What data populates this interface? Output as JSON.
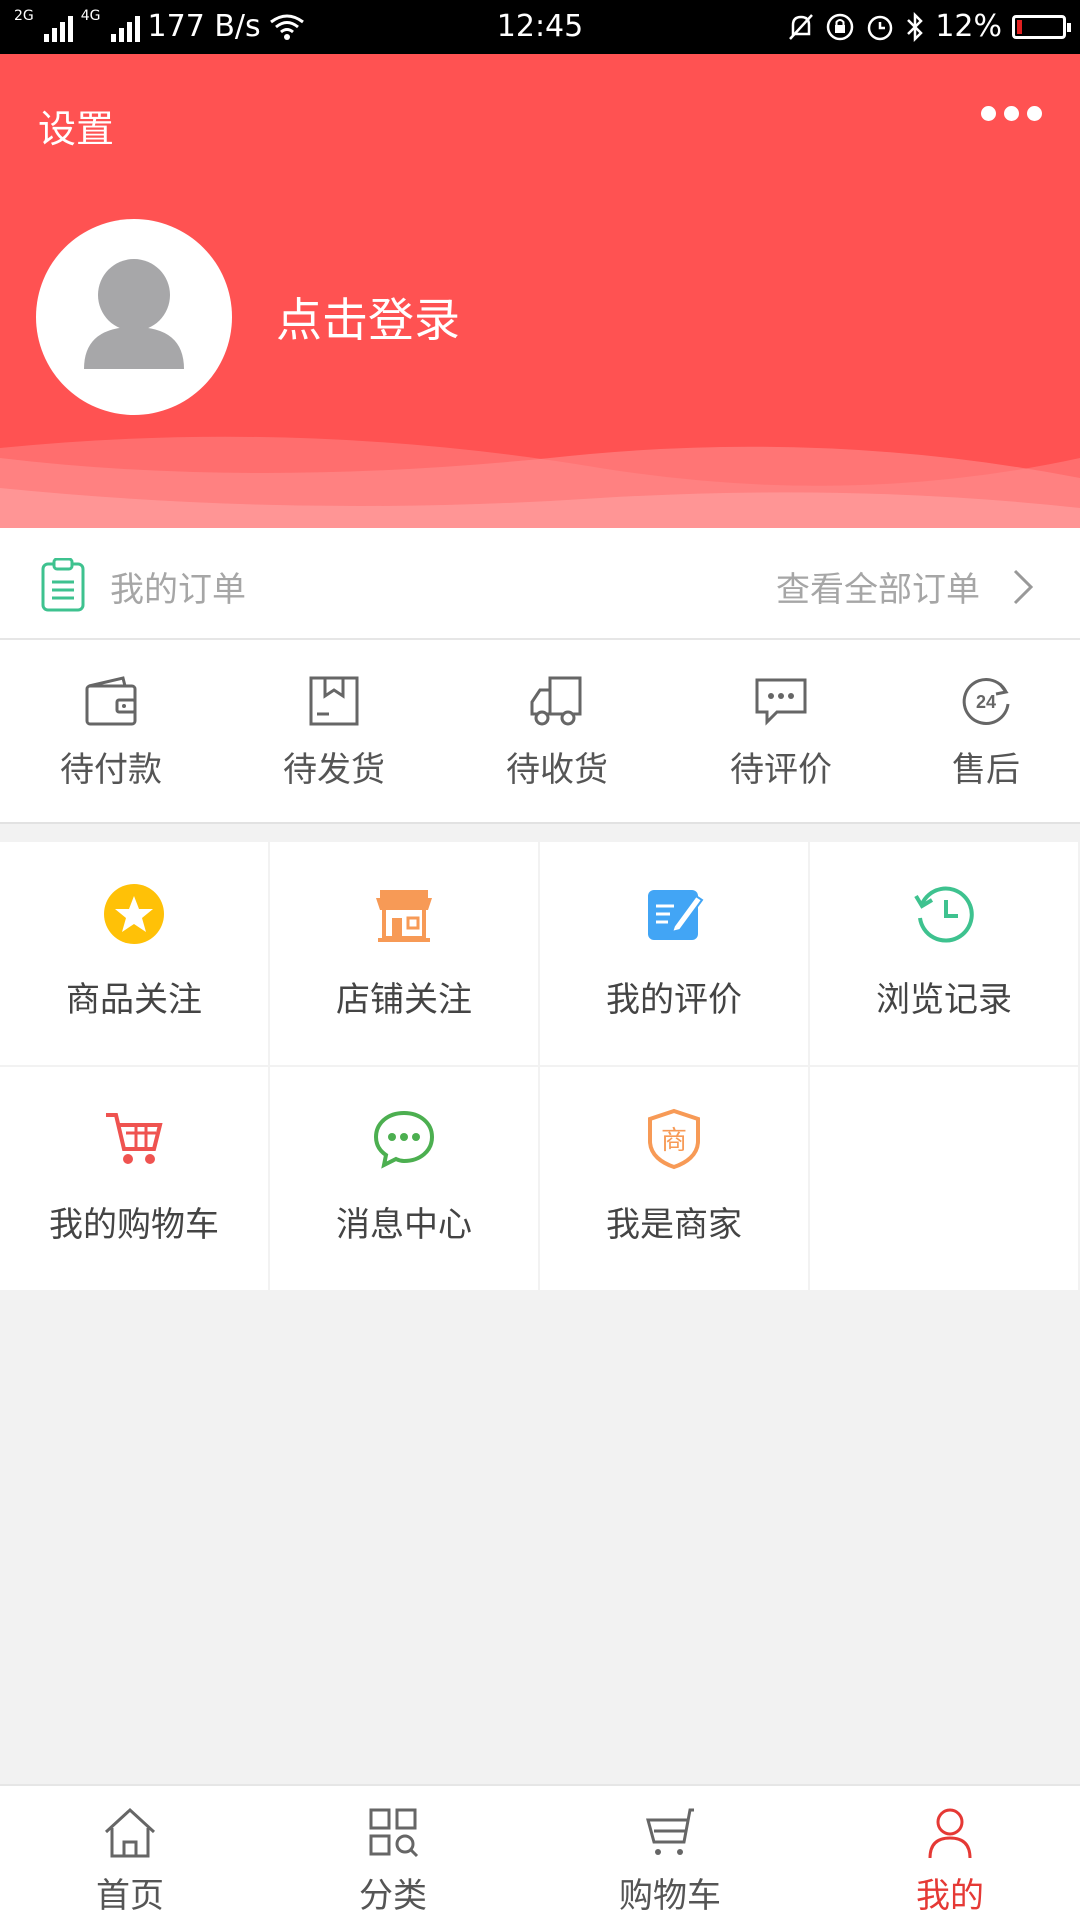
{
  "status_bar": {
    "net1": "2G",
    "net2": "4G",
    "speed": "177 B/s",
    "time": "12:45",
    "battery": "12%",
    "battery_level": 0.12
  },
  "header": {
    "settings": "设置",
    "login": "点击登录",
    "bg_color": "#ff5252"
  },
  "orders": {
    "title": "我的订单",
    "view_all": "查看全部订单",
    "statuses": [
      {
        "label": "待付款",
        "icon": "wallet-icon"
      },
      {
        "label": "待发货",
        "icon": "package-icon"
      },
      {
        "label": "待收货",
        "icon": "truck-icon"
      },
      {
        "label": "待评价",
        "icon": "comment-icon"
      },
      {
        "label": "售后",
        "icon": "service-24h-icon"
      }
    ]
  },
  "features": [
    {
      "label": "商品关注",
      "icon": "star-icon",
      "color": "#ffc107"
    },
    {
      "label": "店铺关注",
      "icon": "store-icon",
      "color": "#f79a56"
    },
    {
      "label": "我的评价",
      "icon": "edit-icon",
      "color": "#42a5f5"
    },
    {
      "label": "浏览记录",
      "icon": "history-icon",
      "color": "#3ec28f"
    },
    {
      "label": "我的购物车",
      "icon": "cart-icon",
      "color": "#ef5350"
    },
    {
      "label": "消息中心",
      "icon": "message-icon",
      "color": "#4caf50"
    },
    {
      "label": "我是商家",
      "icon": "merchant-badge-icon",
      "color": "#f79a56",
      "badge_text": "商"
    }
  ],
  "tabbar": {
    "items": [
      {
        "label": "首页",
        "icon": "home-icon"
      },
      {
        "label": "分类",
        "icon": "category-icon"
      },
      {
        "label": "购物车",
        "icon": "cart-icon"
      },
      {
        "label": "我的",
        "icon": "user-icon",
        "active": true
      }
    ],
    "active_color": "#e53935"
  }
}
